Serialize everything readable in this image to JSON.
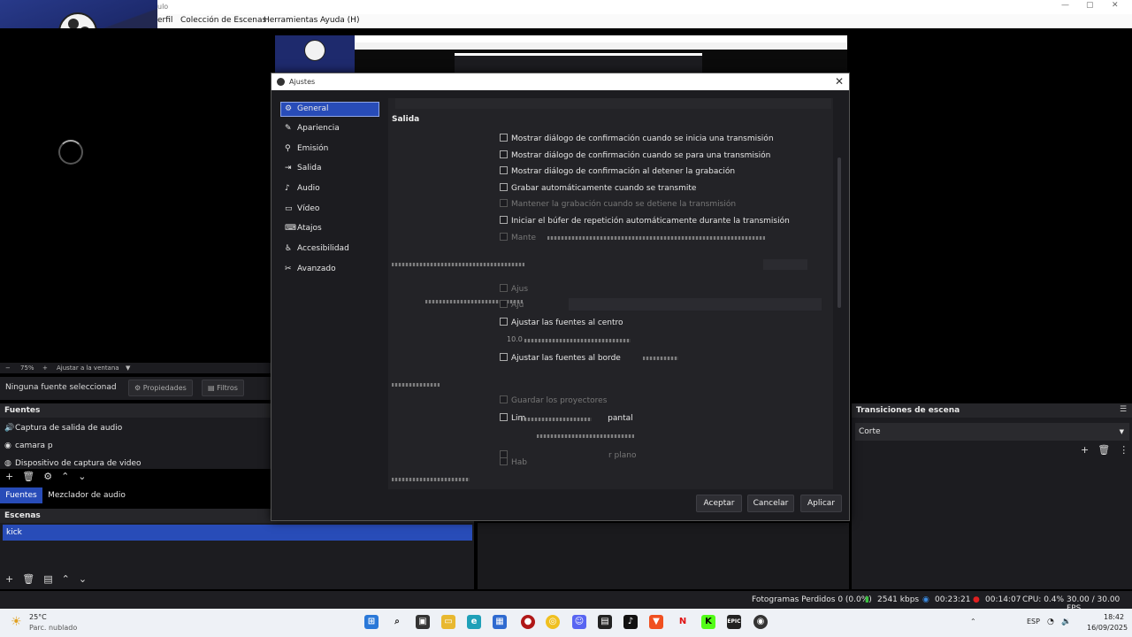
{
  "obs": {
    "title_fragment": "ulo",
    "menu": [
      "erfil",
      "Colección de Escenas",
      "Herramientas",
      "Ayuda (H)"
    ],
    "zoom": {
      "minus": "−",
      "value": "75%",
      "plus": "+",
      "fit_label": "Ajustar a la ventana"
    },
    "source_toolbar": {
      "no_source": "Ninguna fuente seleccionad",
      "properties": "Propiedades",
      "filters": "Filtros"
    },
    "sources_dock": {
      "title": "Fuentes",
      "items": [
        "Captura de salida de audio",
        "camara p",
        "Dispositivo de captura de video"
      ]
    },
    "tabs": {
      "sources": "Fuentes",
      "mixer": "Mezclador de audio"
    },
    "scenes_dock": {
      "title": "Escenas",
      "items": [
        "kick"
      ]
    },
    "transitions_dock": {
      "title": "Transiciones de escena",
      "selected": "Corte"
    },
    "status": {
      "dropped_frames": "Fotogramas Perdidos 0 (0.0%)",
      "bitrate": "2541 kbps",
      "stream_time": "00:23:21",
      "rec_time": "00:14:07",
      "cpu": "CPU: 0.4%",
      "fps": "30.00 / 30.00 FPS"
    }
  },
  "settings": {
    "title": "Ajustes",
    "close": "✕",
    "sidebar": [
      {
        "label": "General",
        "icon": "gear-icon",
        "active": true
      },
      {
        "label": "Apariencia",
        "icon": "brush-icon"
      },
      {
        "label": "Emisión",
        "icon": "antenna-icon"
      },
      {
        "label": "Salida",
        "icon": "output-icon"
      },
      {
        "label": "Audio",
        "icon": "speaker-icon"
      },
      {
        "label": "Vídeo",
        "icon": "monitor-icon"
      },
      {
        "label": "Atajos",
        "icon": "keyboard-icon"
      },
      {
        "label": "Accesibilidad",
        "icon": "accessibility-icon"
      },
      {
        "label": "Avanzado",
        "icon": "tools-icon"
      }
    ],
    "section": "Salida",
    "checkboxes": [
      "Mostrar diálogo de confirmación cuando se inicia una transmisión",
      "Mostrar diálogo de confirmación cuando se para una transmisión",
      "Mostrar diálogo de confirmación al detener la grabación",
      "Grabar automáticamente cuando se transmite",
      "Mantener la grabación cuando se detiene la transmisión",
      "Iniciar el búfer de repetición automáticamente durante la transmisión"
    ],
    "partial_texts": {
      "mante": "Mante",
      "ajus1": "Ajus",
      "ajus2": "Aju",
      "centro": "Ajustar las fuentes al centro",
      "value": "10.0",
      "borde": "Ajustar las fuentes al borde",
      "guardar": "Guardar los proyectores",
      "lim": "Lim",
      "pantal": "pantal",
      "hab": "Hab",
      "plano": "r plano"
    },
    "buttons": {
      "accept": "Aceptar",
      "cancel": "Cancelar",
      "apply": "Aplicar"
    }
  },
  "taskbar": {
    "weather_temp": "25°C",
    "weather_desc": "Parc. nublado",
    "lang": "ESP",
    "time": "18:42",
    "date": "16/09/2025"
  },
  "colors": {
    "accent_blue": "#284cb8",
    "dock_bg": "#1c1c20",
    "rec_red": "#e02020",
    "bitrate_green": "#3ac040"
  }
}
